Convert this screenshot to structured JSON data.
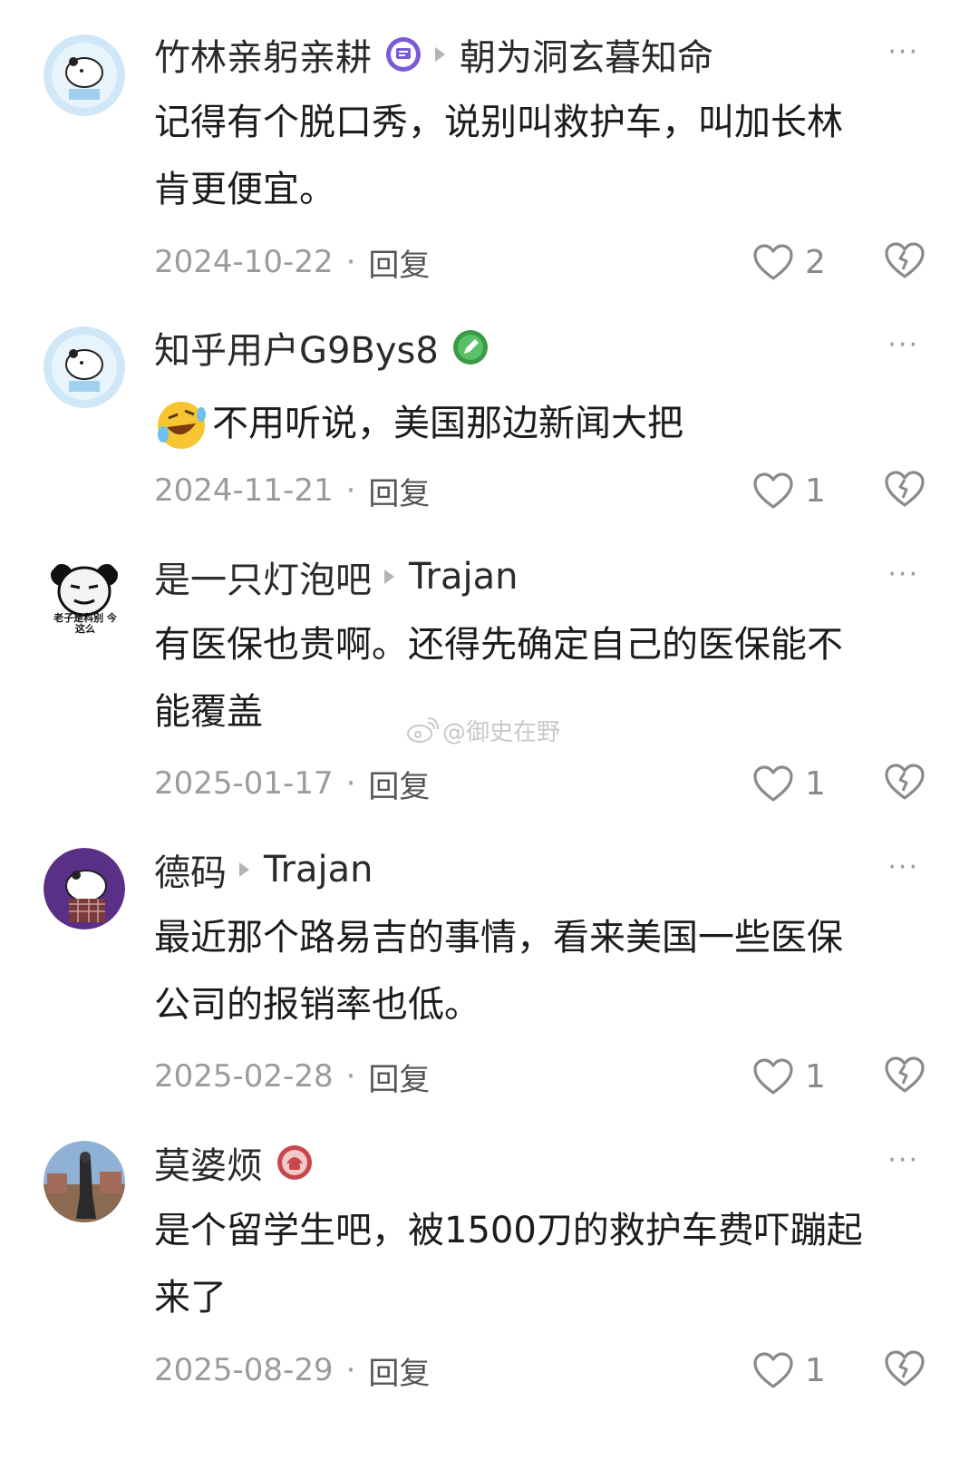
{
  "comments": [
    {
      "user": "竹林亲躬亲耕",
      "reply_to": "朝为洞玄暮知命",
      "text_lines": [
        "记得有个脱口秀，说别叫救护车，叫加长林",
        "肯更便宜。"
      ],
      "date": "2024-10-22",
      "reply_label": "回复",
      "likes": "2",
      "badge": "purple-chat-badge"
    },
    {
      "user": "知乎用户G9Bys8",
      "reply_to": "",
      "text_lines": [
        "不用听说，美国那边新闻大把"
      ],
      "emoji": "rofl-emoji",
      "date": "2024-11-21",
      "reply_label": "回复",
      "likes": "1",
      "badge": "green-pen-badge"
    },
    {
      "user": "是一只灯泡吧",
      "reply_to": "Trajan",
      "text_lines": [
        "有医保也贵啊。还得先确定自己的医保能不",
        "能覆盖"
      ],
      "date": "2025-01-17",
      "reply_label": "回复",
      "likes": "1"
    },
    {
      "user": "德码",
      "reply_to": "Trajan",
      "text_lines": [
        "最近那个路易吉的事情，看来美国一些医保",
        "公司的报销率也低。"
      ],
      "date": "2025-02-28",
      "reply_label": "回复",
      "likes": "1"
    },
    {
      "user": "莫婆烦",
      "reply_to": "",
      "text_lines": [
        "是个留学生吧，被1500刀的救护车费吓蹦起",
        "来了"
      ],
      "date": "2025-08-29",
      "reply_label": "回复",
      "likes": "1",
      "badge": "red-helmet-badge"
    }
  ],
  "more_label": "···",
  "watermark": "@御史在野",
  "avatar_text_3": "老子是科别 今这么",
  "colors": {
    "purple_badge": "#7b5bd6",
    "green_badge": "#3a9a45",
    "red_badge": "#c9464a",
    "text_muted": "#9b9b9b"
  }
}
